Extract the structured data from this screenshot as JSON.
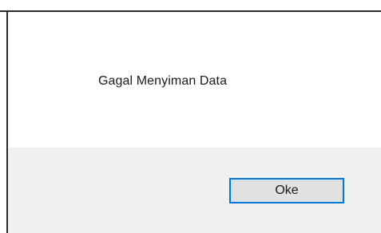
{
  "dialog": {
    "message": "Gagal Menyiman Data",
    "ok_label": "Oke"
  },
  "colors": {
    "content_background": "#ffffff",
    "footer_background": "#f0f0f0",
    "button_background": "#e1e1e1",
    "button_focus_border": "#0078d7",
    "frame": "#2a2a2a",
    "text": "#1a1a1a"
  }
}
